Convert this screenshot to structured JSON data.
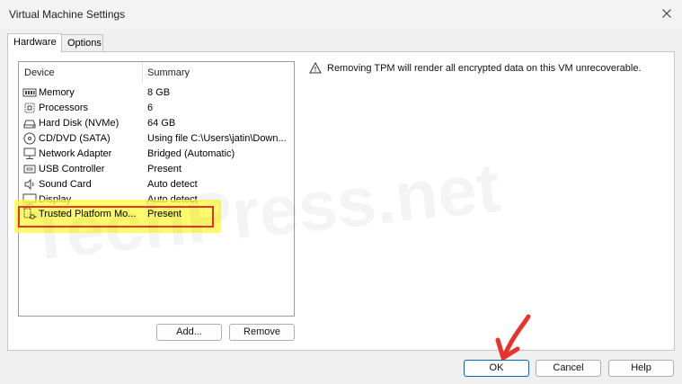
{
  "window": {
    "title": "Virtual Machine Settings"
  },
  "tabs": [
    {
      "label": "Hardware",
      "active": true
    },
    {
      "label": "Options",
      "active": false
    }
  ],
  "device_list": {
    "columns": [
      "Device",
      "Summary"
    ],
    "rows": [
      {
        "name": "Memory",
        "summary": "8 GB",
        "icon": "memory-icon"
      },
      {
        "name": "Processors",
        "summary": "6",
        "icon": "processor-icon"
      },
      {
        "name": "Hard Disk (NVMe)",
        "summary": "64 GB",
        "icon": "hard-disk-icon"
      },
      {
        "name": "CD/DVD (SATA)",
        "summary": "Using file C:\\Users\\jatin\\Down...",
        "icon": "cd-dvd-icon"
      },
      {
        "name": "Network Adapter",
        "summary": "Bridged (Automatic)",
        "icon": "network-adapter-icon"
      },
      {
        "name": "USB Controller",
        "summary": "Present",
        "icon": "usb-icon"
      },
      {
        "name": "Sound Card",
        "summary": "Auto detect",
        "icon": "speaker-icon"
      },
      {
        "name": "Display",
        "summary": "Auto detect",
        "icon": "display-icon"
      }
    ],
    "selected_row": {
      "name": "Trusted Platform Mo...",
      "summary": "Present",
      "icon": "tpm-icon"
    }
  },
  "info": {
    "message": "Removing TPM will render all encrypted data on this VM unrecoverable."
  },
  "buttons": {
    "add": "Add...",
    "remove": "Remove",
    "ok": "OK",
    "cancel": "Cancel",
    "help": "Help"
  },
  "watermark": "TechPress.net",
  "colors": {
    "highlight": "#fff96a",
    "annotation_red": "#e8332a",
    "ok_border": "#0067c0"
  }
}
